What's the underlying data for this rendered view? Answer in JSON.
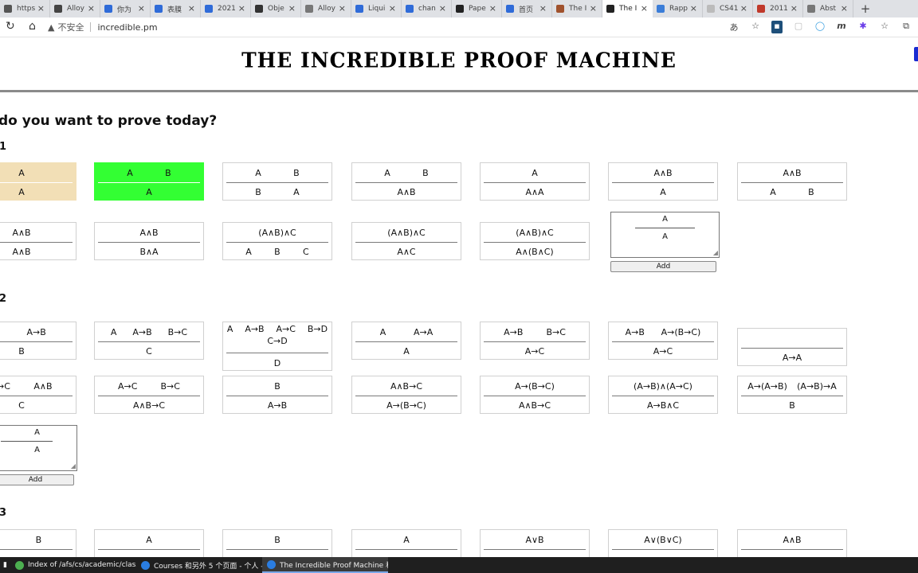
{
  "tabs": [
    {
      "title": "https",
      "favicon": "page-icon",
      "color": "#555555"
    },
    {
      "title": "Alloy",
      "favicon": "page-icon",
      "color": "#444444"
    },
    {
      "title": "你为",
      "favicon": "eye-icon",
      "color": "#2f6bd8"
    },
    {
      "title": "表膜",
      "favicon": "eye-icon",
      "color": "#2f6bd8"
    },
    {
      "title": "2021",
      "favicon": "eye-icon",
      "color": "#2f6bd8"
    },
    {
      "title": "Obje",
      "favicon": "wikipedia-icon",
      "color": "#333333"
    },
    {
      "title": "Alloy",
      "favicon": "document-icon",
      "color": "#777777"
    },
    {
      "title": "Liqui",
      "favicon": "chart-icon",
      "color": "#2f6bd8"
    },
    {
      "title": "chan",
      "favicon": "baidu-icon",
      "color": "#2f6bd8"
    },
    {
      "title": "Pape",
      "favicon": "grid-icon",
      "color": "#222222"
    },
    {
      "title": "首页",
      "favicon": "baidu-icon",
      "color": "#2f6bd8"
    },
    {
      "title": "The I",
      "favicon": "avatar-icon",
      "color": "#a0522d"
    },
    {
      "title": "The I",
      "favicon": "proof-machine-icon",
      "color": "#222222",
      "active": true
    },
    {
      "title": "Rapp",
      "favicon": "bird-icon",
      "color": "#3b7dd8"
    },
    {
      "title": "CS41",
      "favicon": "blank-icon",
      "color": "#bbbbbb"
    },
    {
      "title": "2011",
      "favicon": "bookmark-icon",
      "color": "#c0392b"
    },
    {
      "title": "Abst",
      "favicon": "document-icon",
      "color": "#777777"
    }
  ],
  "address": {
    "security_label": "不安全",
    "url": "incredible.pm"
  },
  "page": {
    "title": "THE INCREDIBLE PROOF MACHINE",
    "question": "do you want to prove today?",
    "sections": [
      {
        "label": "1"
      },
      {
        "label": "2"
      },
      {
        "label": "3"
      }
    ],
    "add_label": "Add"
  },
  "rules": [
    {
      "id": "s1-1",
      "premises": [
        "A"
      ],
      "conclusions": [
        "A"
      ],
      "state": "tan"
    },
    {
      "id": "s1-2",
      "premises": [
        "A",
        "B"
      ],
      "conclusions": [
        "A"
      ],
      "state": "green"
    },
    {
      "id": "s1-3",
      "premises": [
        "A",
        "B"
      ],
      "conclusions": [
        "B",
        "A"
      ]
    },
    {
      "id": "s1-4",
      "premises": [
        "A",
        "B"
      ],
      "conclusions": [
        "A∧B"
      ]
    },
    {
      "id": "s1-5",
      "premises": [
        "A"
      ],
      "conclusions": [
        "A∧A"
      ]
    },
    {
      "id": "s1-6",
      "premises": [
        "A∧B"
      ],
      "conclusions": [
        "A"
      ]
    },
    {
      "id": "s1-7",
      "premises": [
        "A∧B"
      ],
      "conclusions": [
        "A",
        "B"
      ]
    },
    {
      "id": "s1-8",
      "premises": [
        "A∧B"
      ],
      "conclusions": [
        "A∧B"
      ]
    },
    {
      "id": "s1-9",
      "premises": [
        "A∧B"
      ],
      "conclusions": [
        "B∧A"
      ]
    },
    {
      "id": "s1-10",
      "premises": [
        "(A∧B)∧C"
      ],
      "conclusions": [
        "A",
        "B",
        "C"
      ]
    },
    {
      "id": "s1-11",
      "premises": [
        "(A∧B)∧C"
      ],
      "conclusions": [
        "A∧C"
      ]
    },
    {
      "id": "s1-12",
      "premises": [
        "(A∧B)∧C"
      ],
      "conclusions": [
        "A∧(B∧C)"
      ]
    },
    {
      "id": "s2-1",
      "premises": [
        "",
        "A→B"
      ],
      "conclusions": [
        "B"
      ]
    },
    {
      "id": "s2-2",
      "premises": [
        "A",
        "A→B",
        "B→C"
      ],
      "conclusions": [
        "C"
      ]
    },
    {
      "id": "s2-3",
      "premises": [
        "A",
        "A→B",
        "A→C",
        "B→D",
        "C→D"
      ],
      "conclusions": [
        "D"
      ],
      "tall": true
    },
    {
      "id": "s2-4",
      "premises": [
        "A",
        "A→A"
      ],
      "conclusions": [
        "A"
      ]
    },
    {
      "id": "s2-5",
      "premises": [
        "A→B",
        "B→C"
      ],
      "conclusions": [
        "A→C"
      ]
    },
    {
      "id": "s2-6",
      "premises": [
        "A→B",
        "A→(B→C)"
      ],
      "conclusions": [
        "A→C"
      ]
    },
    {
      "id": "s2-7",
      "premises": [],
      "conclusions": [
        "A→A"
      ]
    },
    {
      "id": "s2-8",
      "premises": [
        "B→C",
        "A∧B"
      ],
      "conclusions": [
        "C"
      ]
    },
    {
      "id": "s2-9",
      "premises": [
        "A→C",
        "B→C"
      ],
      "conclusions": [
        "A∧B→C"
      ]
    },
    {
      "id": "s2-10",
      "premises": [
        "B"
      ],
      "conclusions": [
        "A→B"
      ]
    },
    {
      "id": "s2-11",
      "premises": [
        "A∧B→C"
      ],
      "conclusions": [
        "A→(B→C)"
      ]
    },
    {
      "id": "s2-12",
      "premises": [
        "A→(B→C)"
      ],
      "conclusions": [
        "A∧B→C"
      ]
    },
    {
      "id": "s2-13",
      "premises": [
        "(A→B)∧(A→C)"
      ],
      "conclusions": [
        "A→B∧C"
      ]
    },
    {
      "id": "s2-14",
      "premises": [
        "A→(A→B)",
        "(A→B)→A"
      ],
      "conclusions": [
        "B"
      ]
    },
    {
      "id": "s3-1",
      "premises": [
        "",
        "B"
      ],
      "conclusions": []
    },
    {
      "id": "s3-2",
      "premises": [
        "A"
      ],
      "conclusions": []
    },
    {
      "id": "s3-3",
      "premises": [
        "B"
      ],
      "conclusions": []
    },
    {
      "id": "s3-4",
      "premises": [
        "A"
      ],
      "conclusions": []
    },
    {
      "id": "s3-5",
      "premises": [
        "A∨B"
      ],
      "conclusions": []
    },
    {
      "id": "s3-6",
      "premises": [
        "A∨(B∨C)"
      ],
      "conclusions": []
    },
    {
      "id": "s3-7",
      "premises": [
        "A∧B"
      ],
      "conclusions": []
    }
  ],
  "editors": [
    {
      "id": "ed-1",
      "premise": "A",
      "conclusion": "A"
    },
    {
      "id": "ed-2",
      "premise": "A",
      "conclusion": "A"
    }
  ],
  "taskbar": [
    {
      "label": "Index of /afs/cs/academic/class/...",
      "icon": "chrome-icon",
      "color": "#4caf50"
    },
    {
      "label": "Courses 和另外 5 个页面 - 个人 - ...",
      "icon": "edge-icon",
      "color": "#2a7de1"
    },
    {
      "label": "The Incredible Proof Machine 和...",
      "icon": "edge-icon",
      "color": "#2a7de1",
      "selected": true
    }
  ],
  "colors": {
    "tan": "#f2dfb6",
    "green": "#33ff33",
    "accent": "#1a2bd1"
  }
}
